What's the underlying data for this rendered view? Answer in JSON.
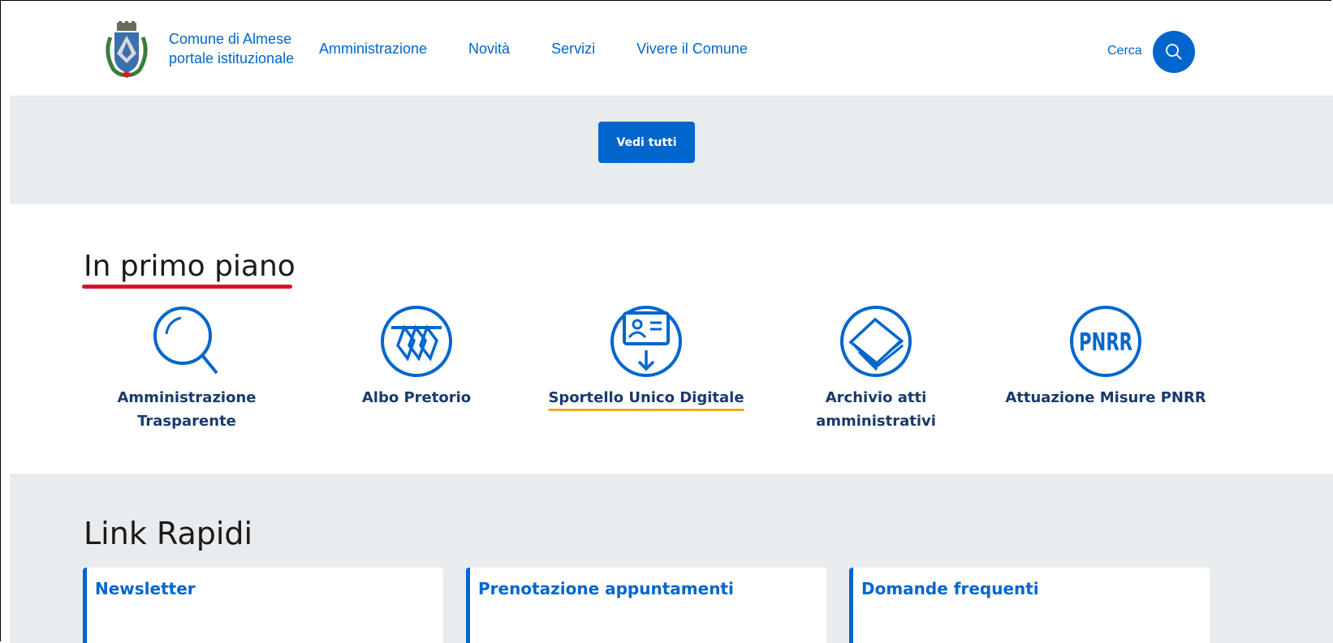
{
  "header": {
    "brand_line1": "Comune di Almese",
    "brand_line2": "portale istituzionale",
    "nav": [
      "Amministrazione",
      "Novità",
      "Servizi",
      "Vivere il Comune"
    ],
    "search_label": "Cerca"
  },
  "band": {
    "button_label": "Vedi tutti"
  },
  "in_primo_piano": {
    "title": "In primo piano",
    "cards": [
      {
        "label_line1": "Amministrazione",
        "label_line2": "Trasparente",
        "icon": "magnifier-icon"
      },
      {
        "label_line1": "Albo Pretorio",
        "label_line2": "",
        "icon": "tags-icon"
      },
      {
        "label_line1": "Sportello Unico Digitale",
        "label_line2": "",
        "icon": "id-card-download-icon"
      },
      {
        "label_line1": "Archivio atti amministrativi",
        "label_line2": "",
        "icon": "books-icon"
      },
      {
        "label_line1": "Attuazione Misure PNRR",
        "label_line2": "",
        "icon": "pnrr-icon"
      }
    ]
  },
  "link_rapidi": {
    "title": "Link Rapidi",
    "items": [
      "Newsletter",
      "Prenotazione appuntamenti",
      "Domande frequenti"
    ]
  },
  "colors": {
    "primary": "#0066cc",
    "underline_red": "#d8122a",
    "underline_orange": "#f5a623",
    "band": "#e9ecee"
  }
}
